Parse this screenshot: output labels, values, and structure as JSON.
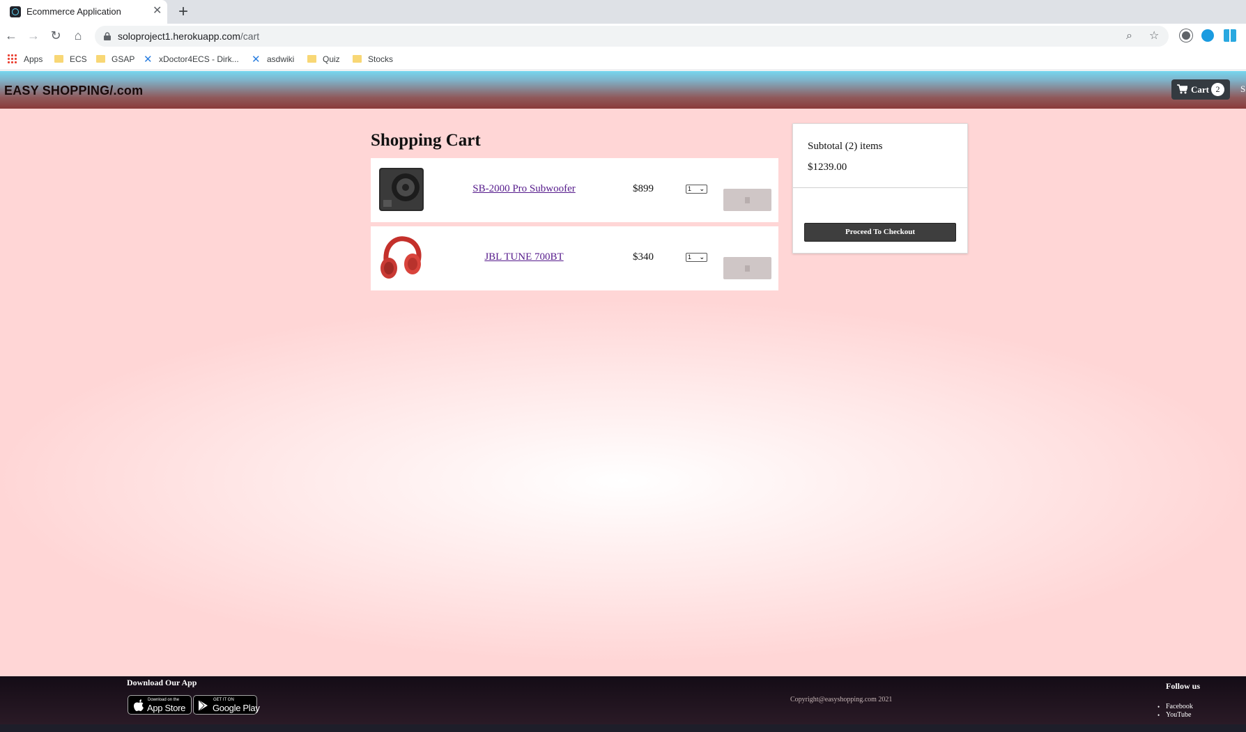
{
  "browser": {
    "tab_title": "Ecommerce Application",
    "url_host": "soloproject1.herokuapp.com",
    "url_path": "/cart",
    "bookmarks": [
      "Apps",
      "ECS",
      "GSAP",
      "xDoctor4ECS - Dirk...",
      "asdwiki",
      "Quiz",
      "Stocks"
    ]
  },
  "navbar": {
    "brand": "EASY SHOPPING/.com",
    "cart_label": "Cart",
    "cart_count": "2",
    "signin_peek": "S"
  },
  "cart": {
    "title": "Shopping Cart",
    "items": [
      {
        "name": "SB-2000 Pro Subwoofer",
        "price": "$899",
        "qty": "1",
        "image": "subwoofer-image"
      },
      {
        "name": "JBL TUNE 700BT",
        "price": "$340",
        "qty": "1",
        "image": "headphones-image"
      }
    ]
  },
  "summary": {
    "subtotal": "Subtotal (2) items",
    "total": "$1239.00",
    "checkout_label": "Proceed To Checkout"
  },
  "footer": {
    "download_title": "Download Our App",
    "app_store_small": "Download on the",
    "app_store_big": "App Store",
    "google_play_small": "GET IT ON",
    "google_play_big": "Google Play",
    "copyright": "Copyright@easyshopping.com 2021",
    "follow_title": "Follow us",
    "follow_links": [
      "Facebook",
      "YouTube"
    ]
  },
  "colors": {
    "checkout_bg": "#3e3e3e",
    "link": "#551a8b",
    "navbar_top": "#76d6ee",
    "navbar_bottom": "#8a3a3a"
  }
}
